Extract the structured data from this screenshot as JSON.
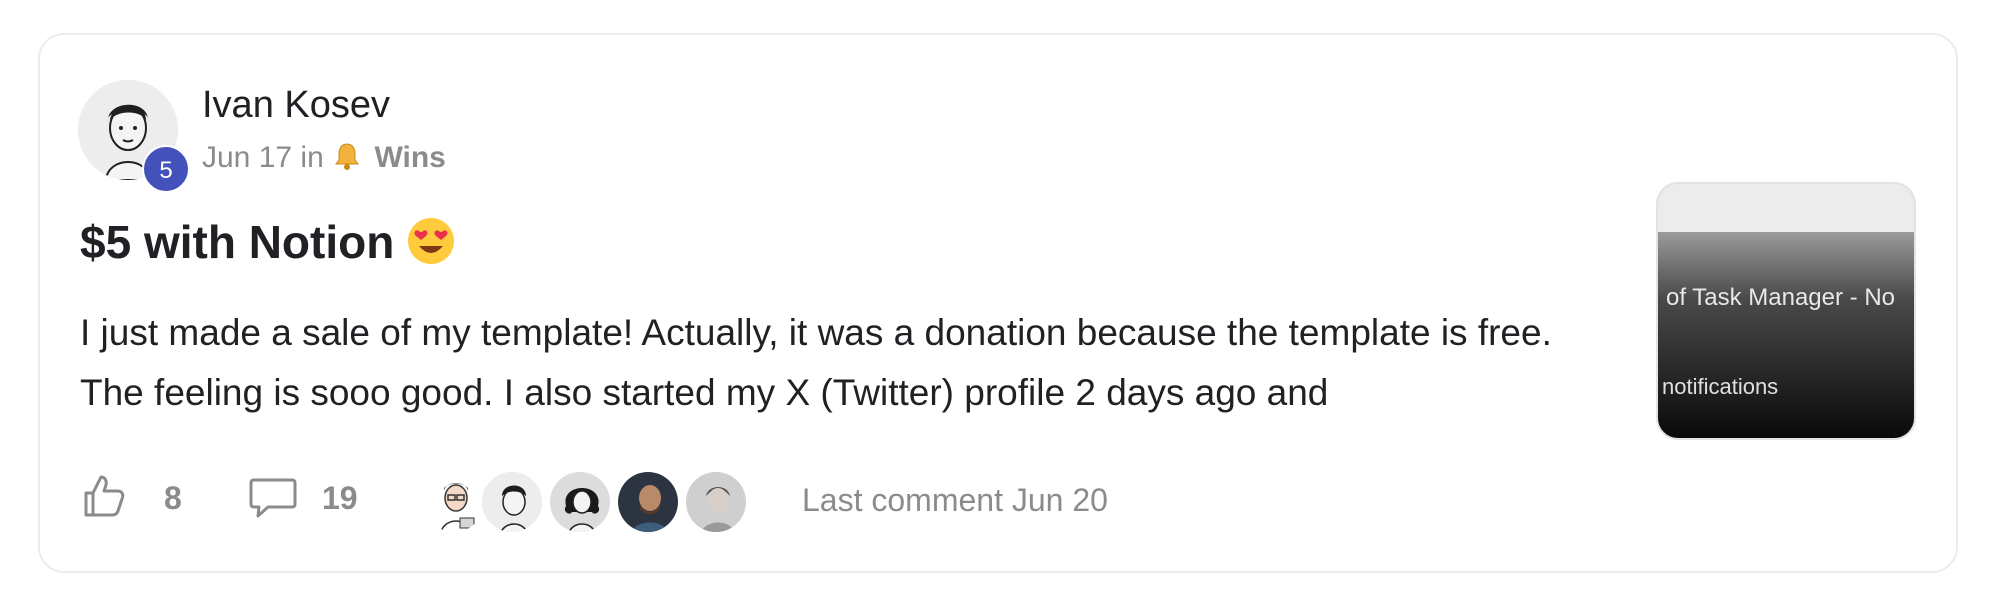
{
  "post": {
    "author_name": "Ivan Kosev",
    "level": "5",
    "date": "Jun 17",
    "in_word": "in",
    "category_icon": "bell-icon",
    "category": "Wins",
    "title": "$5 with Notion",
    "title_emoji": "heart-eyes-emoji",
    "body": "I just made a sale of my template! Actually, it was a donation because the template is free. The feeling is sooo good. I also started my X (Twitter) profile 2 days ago and",
    "thumbnail": {
      "line1": "of Task Manager - No",
      "line2": "notifications"
    }
  },
  "footer": {
    "like_icon": "thumbs-up-icon",
    "likes": "8",
    "comment_icon": "comment-bubble-icon",
    "comments": "19",
    "last_comment": "Last comment Jun 20"
  },
  "colors": {
    "level_badge": "#4352ba",
    "muted_text": "#8b8b8b",
    "card_border": "#ececec"
  }
}
